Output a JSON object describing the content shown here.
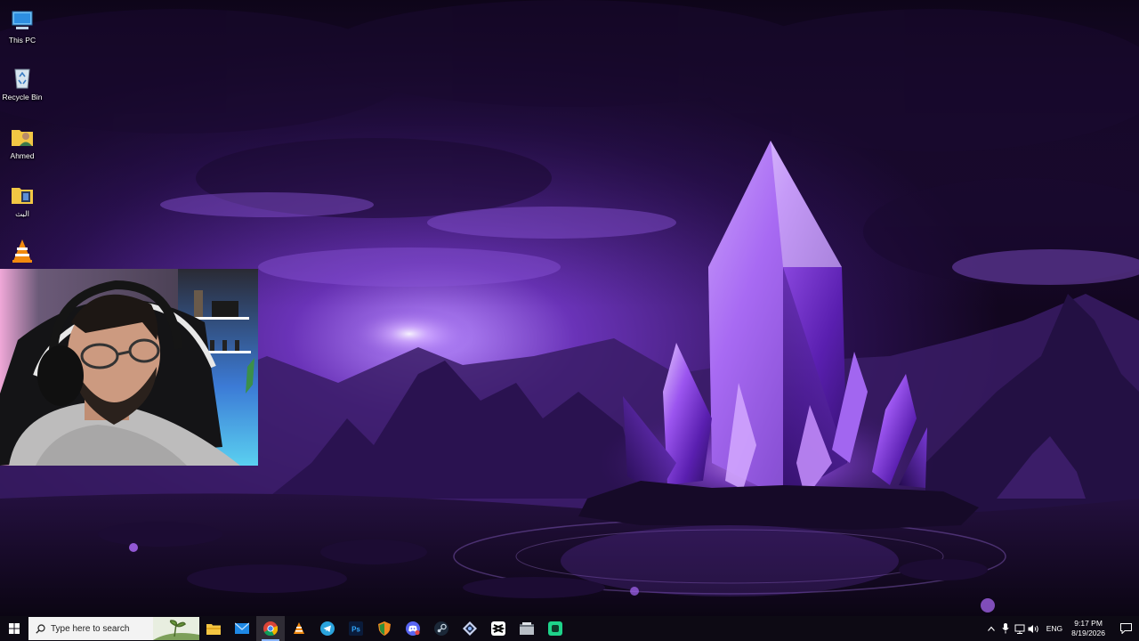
{
  "desktop": {
    "icons": [
      {
        "label": "This PC",
        "icon": "this-pc-icon"
      },
      {
        "label": "Recycle Bin",
        "icon": "recycle-bin-icon"
      },
      {
        "label": "Ahmed",
        "icon": "user-folder-icon"
      },
      {
        "label": "البث",
        "icon": "folder-icon"
      },
      {
        "label": "",
        "icon": "vlc-icon"
      }
    ]
  },
  "webcam": {
    "icon": "webcam-overlay"
  },
  "taskbar": {
    "search_placeholder": "Type here to search",
    "apps": [
      {
        "name": "file-explorer",
        "icon": "file-explorer-icon"
      },
      {
        "name": "mail",
        "icon": "mail-icon"
      },
      {
        "name": "chrome",
        "icon": "chrome-icon",
        "active": true
      },
      {
        "name": "vlc",
        "icon": "vlc-icon"
      },
      {
        "name": "telegram",
        "icon": "telegram-icon"
      },
      {
        "name": "photoshop",
        "icon": "photoshop-icon",
        "text": "Ps"
      },
      {
        "name": "app-shield",
        "icon": "shield-app-icon"
      },
      {
        "name": "discord",
        "icon": "discord-icon"
      },
      {
        "name": "steam",
        "icon": "steam-icon"
      },
      {
        "name": "app-diamond",
        "icon": "diamond-app-icon"
      },
      {
        "name": "capcut",
        "icon": "capcut-icon"
      },
      {
        "name": "app-window",
        "icon": "window-app-icon"
      },
      {
        "name": "app-green",
        "icon": "green-app-icon"
      }
    ],
    "tray": {
      "language": "ENG",
      "time": "9:17 PM",
      "date": "8/19/2026"
    }
  },
  "colors": {
    "taskbar_bg": "#0d0a14",
    "wallpaper_dark": "#140826",
    "wallpaper_purple": "#7a3fd0",
    "crystal_glow": "#c88cff"
  }
}
